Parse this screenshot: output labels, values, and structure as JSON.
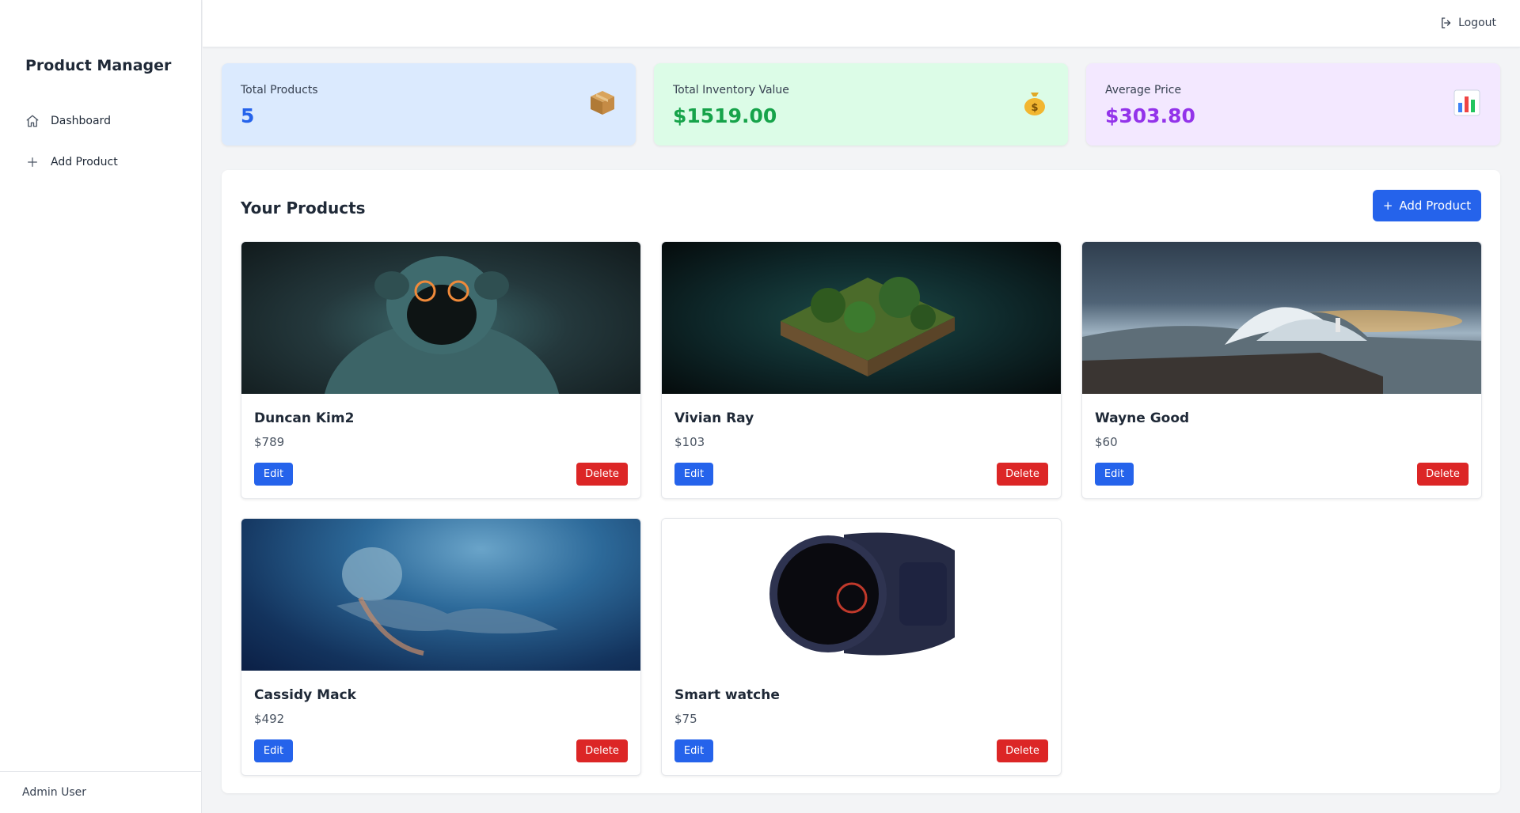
{
  "sidebar": {
    "brand": "Product Manager",
    "items": [
      {
        "label": "Dashboard",
        "icon": "home-icon"
      },
      {
        "label": "Add Product",
        "icon": "plus-icon"
      }
    ],
    "footer_user": "Admin User"
  },
  "topbar": {
    "logout_label": "Logout"
  },
  "stats": [
    {
      "label": "Total Products",
      "value": "5",
      "emoji": "📦",
      "color": "#2563eb",
      "bg": "#dbeafe"
    },
    {
      "label": "Total Inventory Value",
      "value": "$1519.00",
      "emoji": "💰",
      "color": "#16a34a",
      "bg": "#dcfce7"
    },
    {
      "label": "Average Price",
      "value": "$303.80",
      "emoji": "📊",
      "color": "#9333ea",
      "bg": "#f3e8ff"
    }
  ],
  "products_panel": {
    "title": "Your Products",
    "add_button": "+ Add Product",
    "add_button_text": "Add Product",
    "edit_label": "Edit",
    "delete_label": "Delete",
    "products": [
      {
        "name": "Duncan Kim2",
        "price": "$789",
        "image": "hooded-figure-image"
      },
      {
        "name": "Vivian Ray",
        "price": "$103",
        "image": "floating-island-image"
      },
      {
        "name": "Wayne Good",
        "price": "$60",
        "image": "stormy-wave-image"
      },
      {
        "name": "Cassidy Mack",
        "price": "$492",
        "image": "underwater-figure-image"
      },
      {
        "name": "Smart watche",
        "price": "$75",
        "image": "smart-watch-image"
      }
    ]
  },
  "colors": {
    "primary": "#2563eb",
    "danger": "#dc2626"
  }
}
